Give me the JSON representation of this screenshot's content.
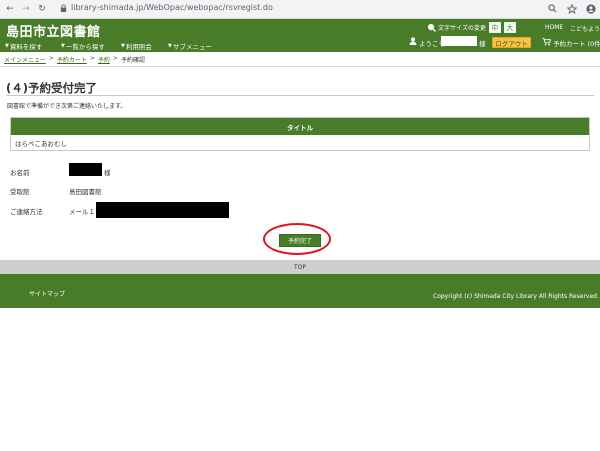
{
  "browser": {
    "url": "library-shimada.jp/WebOpac/webopac/rsvregist.do"
  },
  "header": {
    "site_title": "島田市立図書館",
    "font_size_label": "文字サイズの変更",
    "font_size_medium": "中",
    "font_size_large": "大",
    "home": "HOME",
    "kids": "こどもよう",
    "welcome": "ようこそ",
    "sama": "様",
    "logout": "ログアウト",
    "cart": "予約カート (0件)"
  },
  "menu": {
    "items": [
      "資料を探す",
      "一覧から探す",
      "利用照会",
      "サブメニュー"
    ]
  },
  "breadcrumb": {
    "items": [
      "メインメニュー",
      "予約カート",
      "予約",
      "予約確認"
    ]
  },
  "page": {
    "title": "(４)予約受付完了",
    "notice": "図書館で準備ができ次第ご連絡いたします。"
  },
  "table": {
    "header": "タイトル",
    "rows": [
      "はらぺこあおむし"
    ]
  },
  "info": {
    "name_label": "お名前",
    "name_suffix": "様",
    "pickup_label": "受取館",
    "pickup_value": "島田図書館",
    "contact_label": "ご連絡方法",
    "contact_value": "メール１"
  },
  "confirm_button": "予約完了",
  "footer": {
    "top_link": "TOP",
    "sitemap": "サイトマップ",
    "copyright": "Copyright (c) Shimada City Library All Rights Reserved."
  },
  "colors": {
    "brand_green": "#497c28",
    "logout_yellow": "#f7c341",
    "highlight_red": "#e0141e"
  }
}
